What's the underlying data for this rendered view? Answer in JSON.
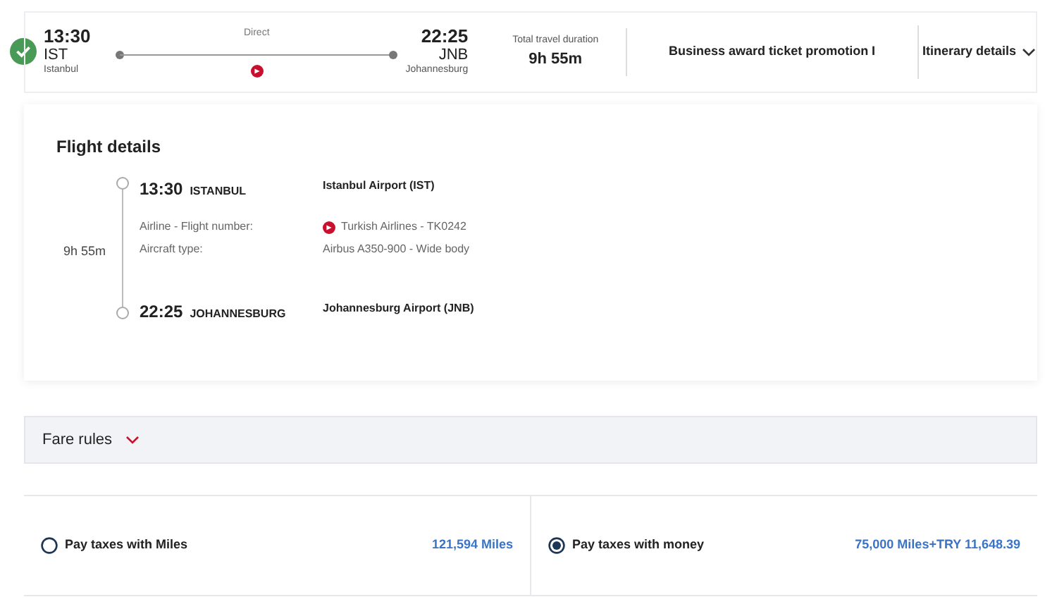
{
  "summary": {
    "selected": true,
    "departure": {
      "time": "13:30",
      "code": "IST",
      "city": "Istanbul"
    },
    "stops": "Direct",
    "arrival": {
      "time": "22:25",
      "code": "JNB",
      "city": "Johannesburg"
    },
    "duration_label": "Total travel duration",
    "duration": "9h 55m",
    "fare": "Business award ticket promotion I",
    "details_toggle": "Itinerary details"
  },
  "flight_details": {
    "title": "Flight details",
    "duration": "9h 55m",
    "departure": {
      "time": "13:30",
      "city": "ISTANBUL",
      "airport": "Istanbul Airport (IST)"
    },
    "info": [
      {
        "label": "Airline - Flight number:",
        "value": "Turkish Airlines - TK0242",
        "kind": "airline"
      },
      {
        "label": "Aircraft type:",
        "value": "Airbus A350-900 - Wide body",
        "kind": "plain"
      }
    ],
    "arrival": {
      "time": "22:25",
      "city": "JOHANNESBURG",
      "airport": "Johannesburg Airport (JNB)"
    }
  },
  "fare_rules": {
    "label": "Fare rules",
    "expanded": false
  },
  "payment_options": [
    {
      "label": "Pay taxes with Miles",
      "price": "121,594 Miles",
      "selected": false
    },
    {
      "label": "Pay taxes with money",
      "price": "75,000 Miles+TRY 11,648.39",
      "selected": true
    }
  ]
}
